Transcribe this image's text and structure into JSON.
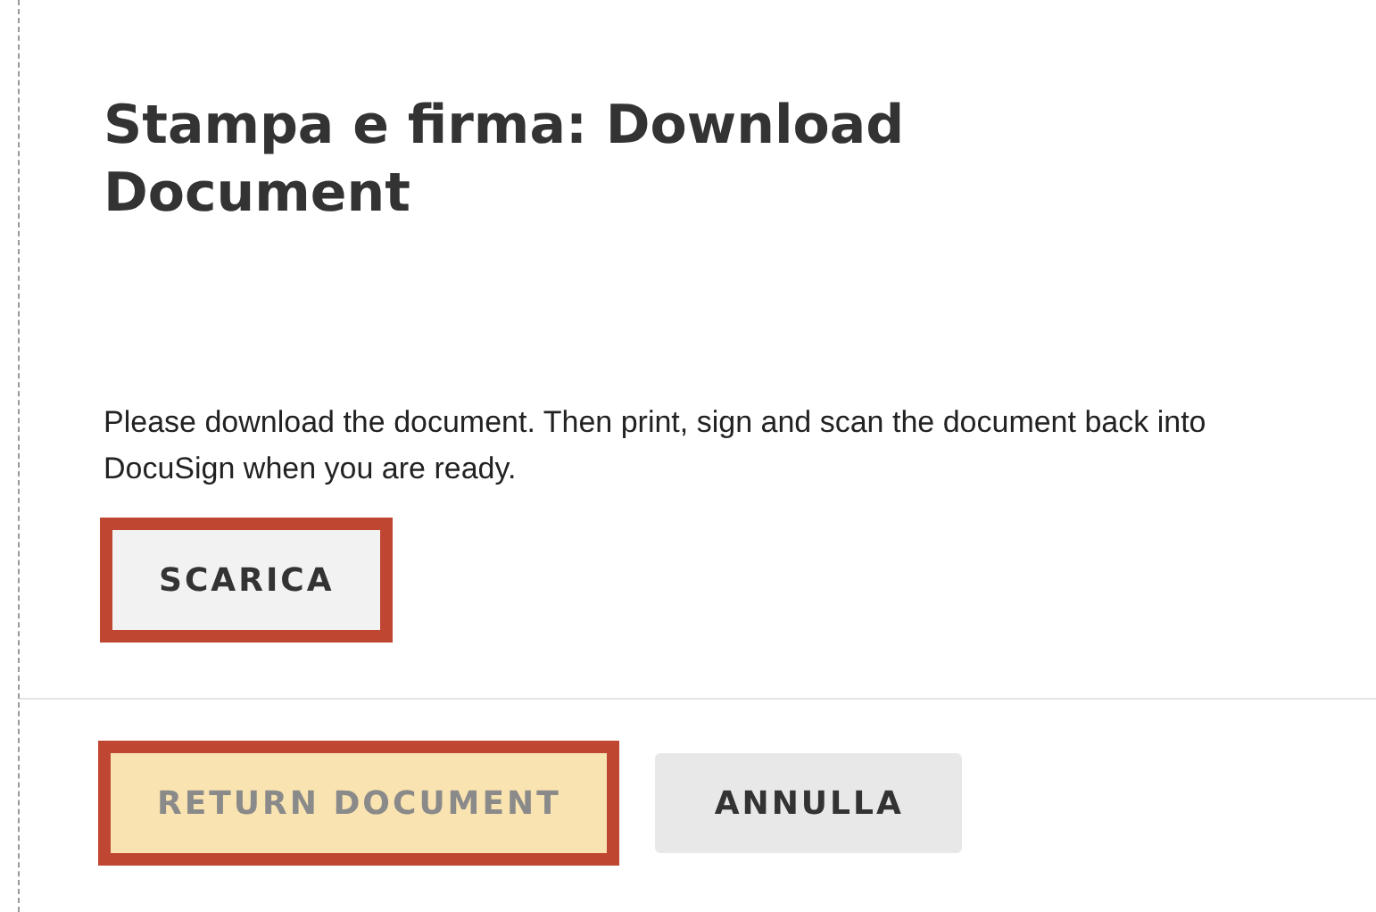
{
  "dialog": {
    "title": "Stampa e firma: Download Document",
    "message": "Please download the document. Then print, sign and scan the document back into DocuSign when you are ready.",
    "download_button": {
      "label": "SCARICA",
      "highlighted": true,
      "disabled": false,
      "kind": "secondary"
    }
  },
  "footer_buttons": [
    {
      "label": "RETURN DOCUMENT",
      "highlighted": true,
      "disabled": true,
      "kind": "primary"
    },
    {
      "label": "ANNULLA",
      "highlighted": false,
      "disabled": false,
      "kind": "secondary"
    }
  ]
}
